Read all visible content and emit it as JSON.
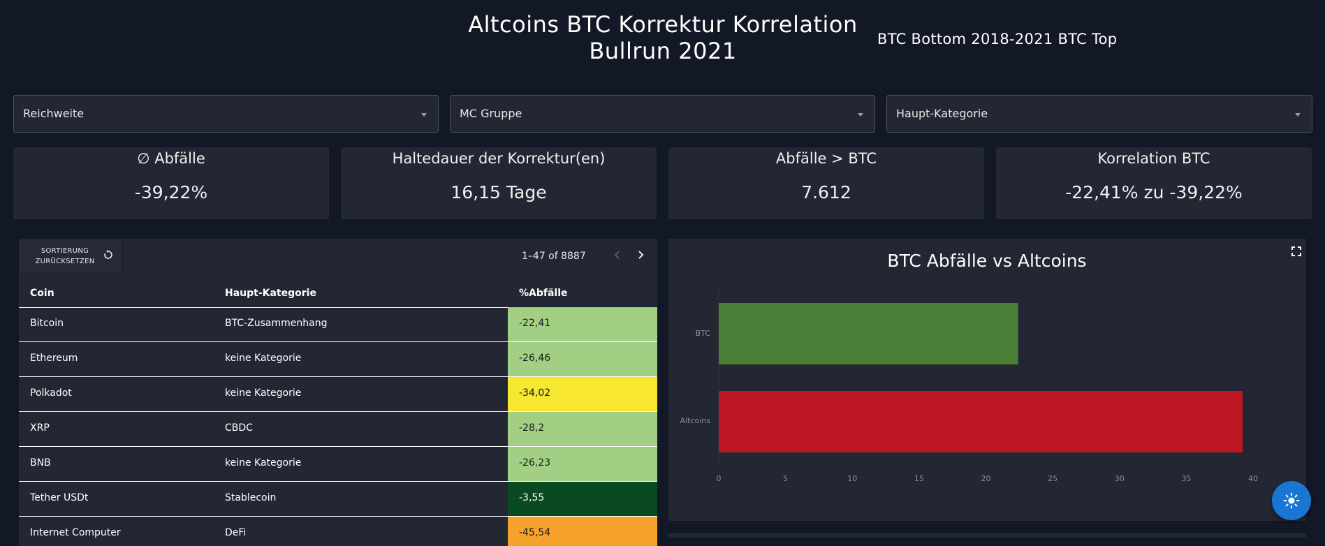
{
  "header": {
    "title_line1": "Altcoins BTC Korrektur Korrelation",
    "title_line2": "Bullrun 2021",
    "subtitle": "BTC Bottom 2018-2021 BTC Top"
  },
  "filters": [
    {
      "label": "Reichweite"
    },
    {
      "label": "MC Gruppe"
    },
    {
      "label": "Haupt-Kategorie"
    }
  ],
  "kpis": [
    {
      "title": "∅ Abfälle",
      "value": "-39,22%"
    },
    {
      "title": "Haltedauer der Korrektur(en)",
      "value": "16,15 Tage"
    },
    {
      "title": "Abfälle > BTC",
      "value": "7.612"
    },
    {
      "title": "Korrelation BTC",
      "value": "-22,41% zu -39,22%"
    }
  ],
  "table": {
    "reset_line1": "SORTIERUNG",
    "reset_line2": "ZURÜCKSETZEN",
    "pagination": "1–47 of 8887",
    "columns": [
      "Coin",
      "Haupt-Kategorie",
      "%Abfälle"
    ],
    "rows": [
      {
        "coin": "Bitcoin",
        "category": "BTC-Zusammenhang",
        "pct": "-22,41",
        "bg": "#a3cf85",
        "fg": "#1a1a1a"
      },
      {
        "coin": "Ethereum",
        "category": "keine Kategorie",
        "pct": "-26,46",
        "bg": "#a3cf85",
        "fg": "#1a1a1a"
      },
      {
        "coin": "Polkadot",
        "category": "keine Kategorie",
        "pct": "-34,02",
        "bg": "#f7e731",
        "fg": "#1a1a1a"
      },
      {
        "coin": "XRP",
        "category": "CBDC",
        "pct": "-28,2",
        "bg": "#a3cf85",
        "fg": "#1a1a1a"
      },
      {
        "coin": "BNB",
        "category": "keine Kategorie",
        "pct": "-26,23",
        "bg": "#a3cf85",
        "fg": "#1a1a1a"
      },
      {
        "coin": "Tether USDt",
        "category": "Stablecoin",
        "pct": "-3,55",
        "bg": "#0a4a22",
        "fg": "#ffffff"
      },
      {
        "coin": "Internet Computer",
        "category": "DeFi",
        "pct": "-45,54",
        "bg": "#f5a12b",
        "fg": "#1a1a1a"
      }
    ]
  },
  "chart_data": {
    "type": "bar",
    "orientation": "horizontal",
    "title": "BTC Abfälle vs Altcoins",
    "categories": [
      "BTC",
      "Altcoins"
    ],
    "values": [
      22.41,
      39.22
    ],
    "colors": [
      "#4a7f37",
      "#bc1622"
    ],
    "xlim": [
      0,
      40
    ],
    "xticks": [
      "0",
      "5",
      "10",
      "15",
      "20",
      "25",
      "30",
      "35",
      "40"
    ],
    "grid": false
  }
}
